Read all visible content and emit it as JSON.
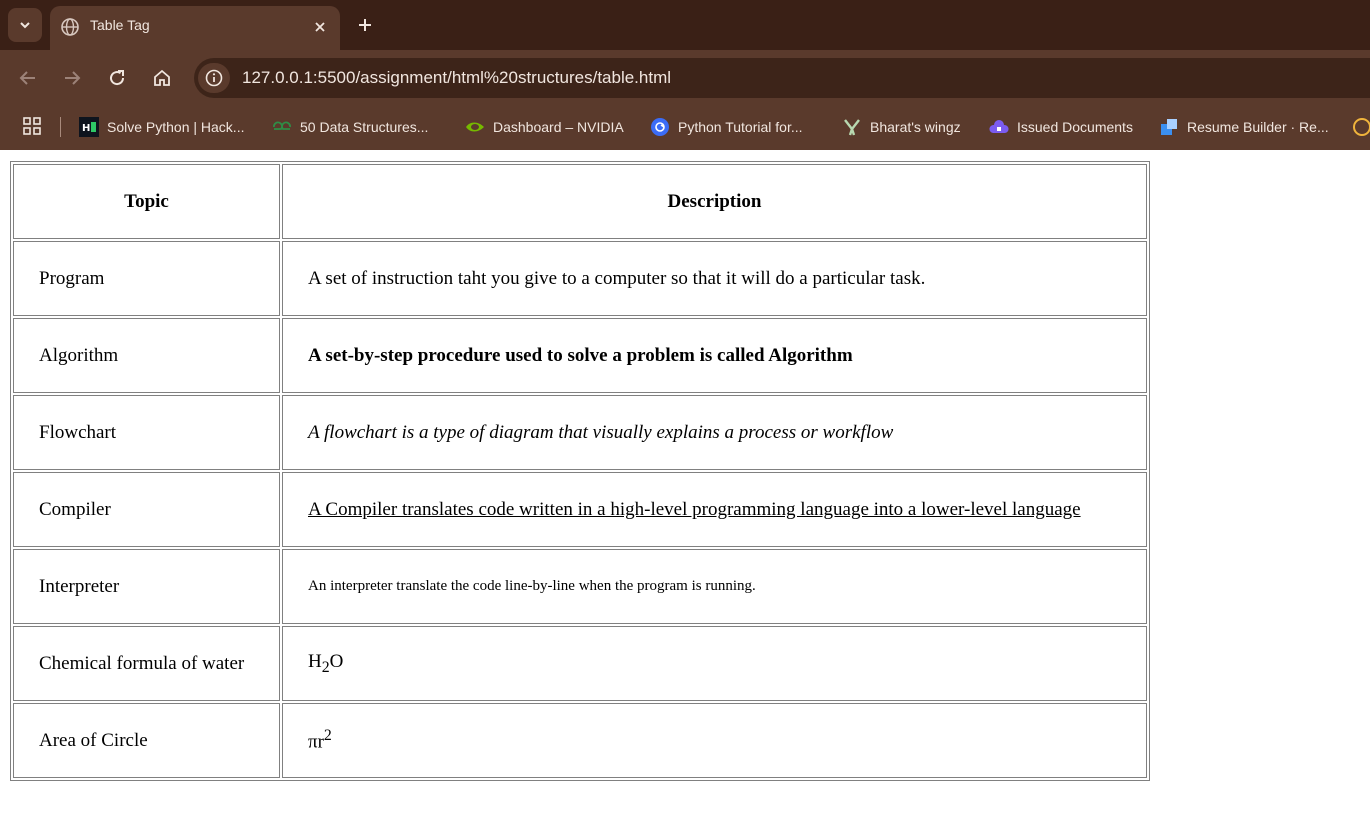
{
  "browser": {
    "tab": {
      "title": "Table Tag"
    },
    "url": "127.0.0.1:5500/assignment/html%20structures/table.html",
    "bookmarks": [
      {
        "label": "Solve Python | Hack...",
        "icon": "hackerrank-icon"
      },
      {
        "label": "50 Data Structures...",
        "icon": "geeksforgeeks-icon"
      },
      {
        "label": "Dashboard – NVIDIA",
        "icon": "nvidia-icon"
      },
      {
        "label": "Python Tutorial for...",
        "icon": "python-tutorial-icon"
      },
      {
        "label": "Bharat's wingz",
        "icon": "wingz-icon"
      },
      {
        "label": "Issued Documents",
        "icon": "cloud-lock-icon"
      },
      {
        "label": "Resume Builder · Re...",
        "icon": "resume-builder-icon"
      }
    ]
  },
  "table": {
    "headers": {
      "topic": "Topic",
      "description": "Description"
    },
    "rows": [
      {
        "topic": "Program",
        "description": "A set of instruction taht you give to a computer so that it will do a particular task."
      },
      {
        "topic": "Algorithm",
        "description": "A set-by-step procedure used to solve a problem is called Algorithm"
      },
      {
        "topic": "Flowchart",
        "description": "A flowchart is a type of diagram that visually explains a process or workflow"
      },
      {
        "topic": "Compiler",
        "description": "A Compiler translates code written in a high-level programming language into a lower-level language"
      },
      {
        "topic": "Interpreter",
        "description": "An interpreter translate the code line-by-line when the program is running."
      },
      {
        "topic": "Chemical formula of water",
        "description_base": "H",
        "description_sub": "2",
        "description_tail": "O"
      },
      {
        "topic": "Area of Circle",
        "description_base": "πr",
        "description_sup": "2"
      }
    ]
  }
}
